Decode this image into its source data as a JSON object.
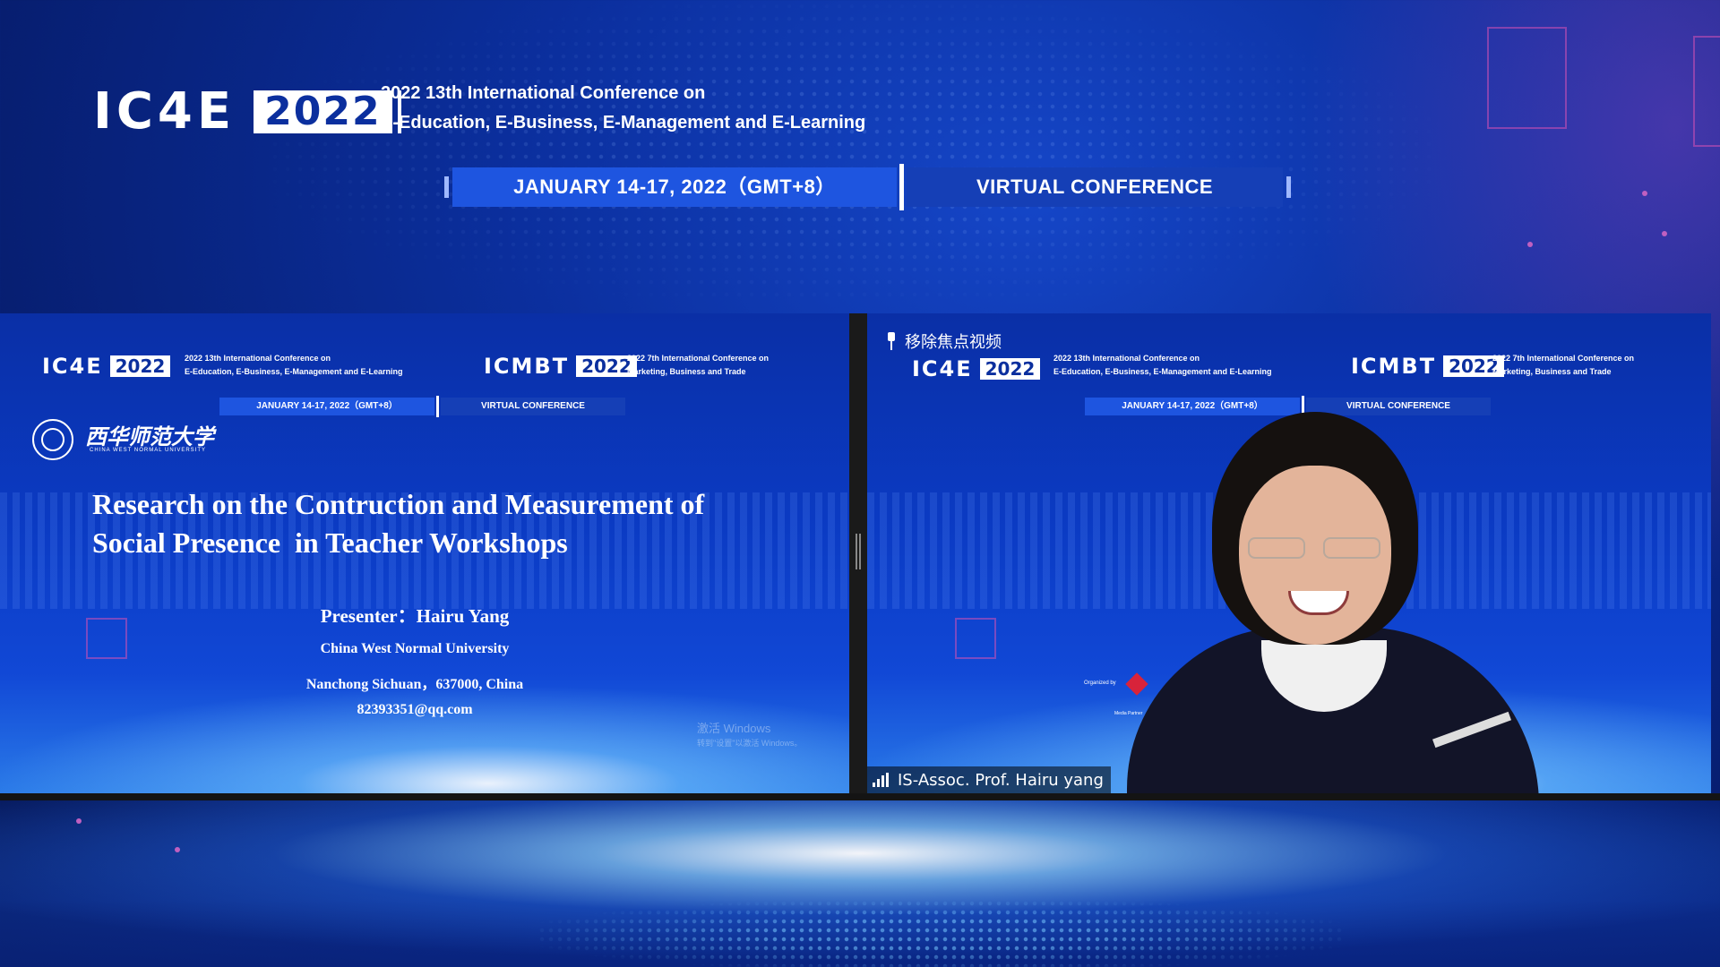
{
  "header": {
    "logo_acronym": "IC4E",
    "logo_year": "2022",
    "conference_title_line1": "2022 13th International Conference on",
    "conference_title_line2": "E-Education, E-Business, E-Management and E-Learning",
    "date_banner": "JANUARY 14-17, 2022（GMT+8）",
    "mode_banner": "VIRTUAL CONFERENCE"
  },
  "left_pane": {
    "ic4e_acronym": "IC4E",
    "ic4e_year": "2022",
    "ic4e_line1": "2022 13th International Conference on",
    "ic4e_line2": "E-Education, E-Business, E-Management and E-Learning",
    "icmbt_acronym": "ICMBT",
    "icmbt_year": "2022",
    "icmbt_line1": "2022 7th International Conference on",
    "icmbt_line2": "Marketing, Business and Trade",
    "date_banner": "JANUARY 14-17, 2022（GMT+8）",
    "mode_banner": "VIRTUAL CONFERENCE",
    "university_name_cn": "西华师范大学",
    "university_name_en": "CHINA WEST NORMAL UNIVERSITY",
    "slide_title_line1": "Research on the Contruction and Measurement of",
    "slide_title_line2": "Social Presence  in Teacher Workshops",
    "presenter": "Presenter：Hairu Yang",
    "affiliation": "China West Normal University",
    "location": "Nanchong Sichuan，637000, China",
    "email": "82393351@qq.com",
    "watermark_line1": "激活 Windows",
    "watermark_line2": "转到\"设置\"以激活 Windows。"
  },
  "right_pane": {
    "remove_focus_label": "移除焦点视频",
    "ic4e_acronym": "IC4E",
    "ic4e_year": "2022",
    "ic4e_line1": "2022 13th International Conference on",
    "ic4e_line2": "E-Education, E-Business, E-Management and E-Learning",
    "icmbt_acronym": "ICMBT",
    "icmbt_year": "2022",
    "icmbt_line1": "2022 7th International Conference on",
    "icmbt_line2": "Marketing, Business and Trade",
    "date_banner": "JANUARY 14-17, 2022（GMT+8）",
    "mode_banner": "VIRTUAL CONFERENCE",
    "organized_by": "Organized by",
    "media_partner": "Media Partner",
    "participant_name": "IS-Assoc. Prof. Hairu yang"
  },
  "icons": {
    "pin": "pin-icon",
    "signal": "signal-strength-icon",
    "university_seal": "university-seal-icon"
  },
  "colors": {
    "background": "#0b2f9e",
    "banner_primary": "#1e55e0",
    "banner_secondary": "#153fb6",
    "white": "#ffffff"
  }
}
